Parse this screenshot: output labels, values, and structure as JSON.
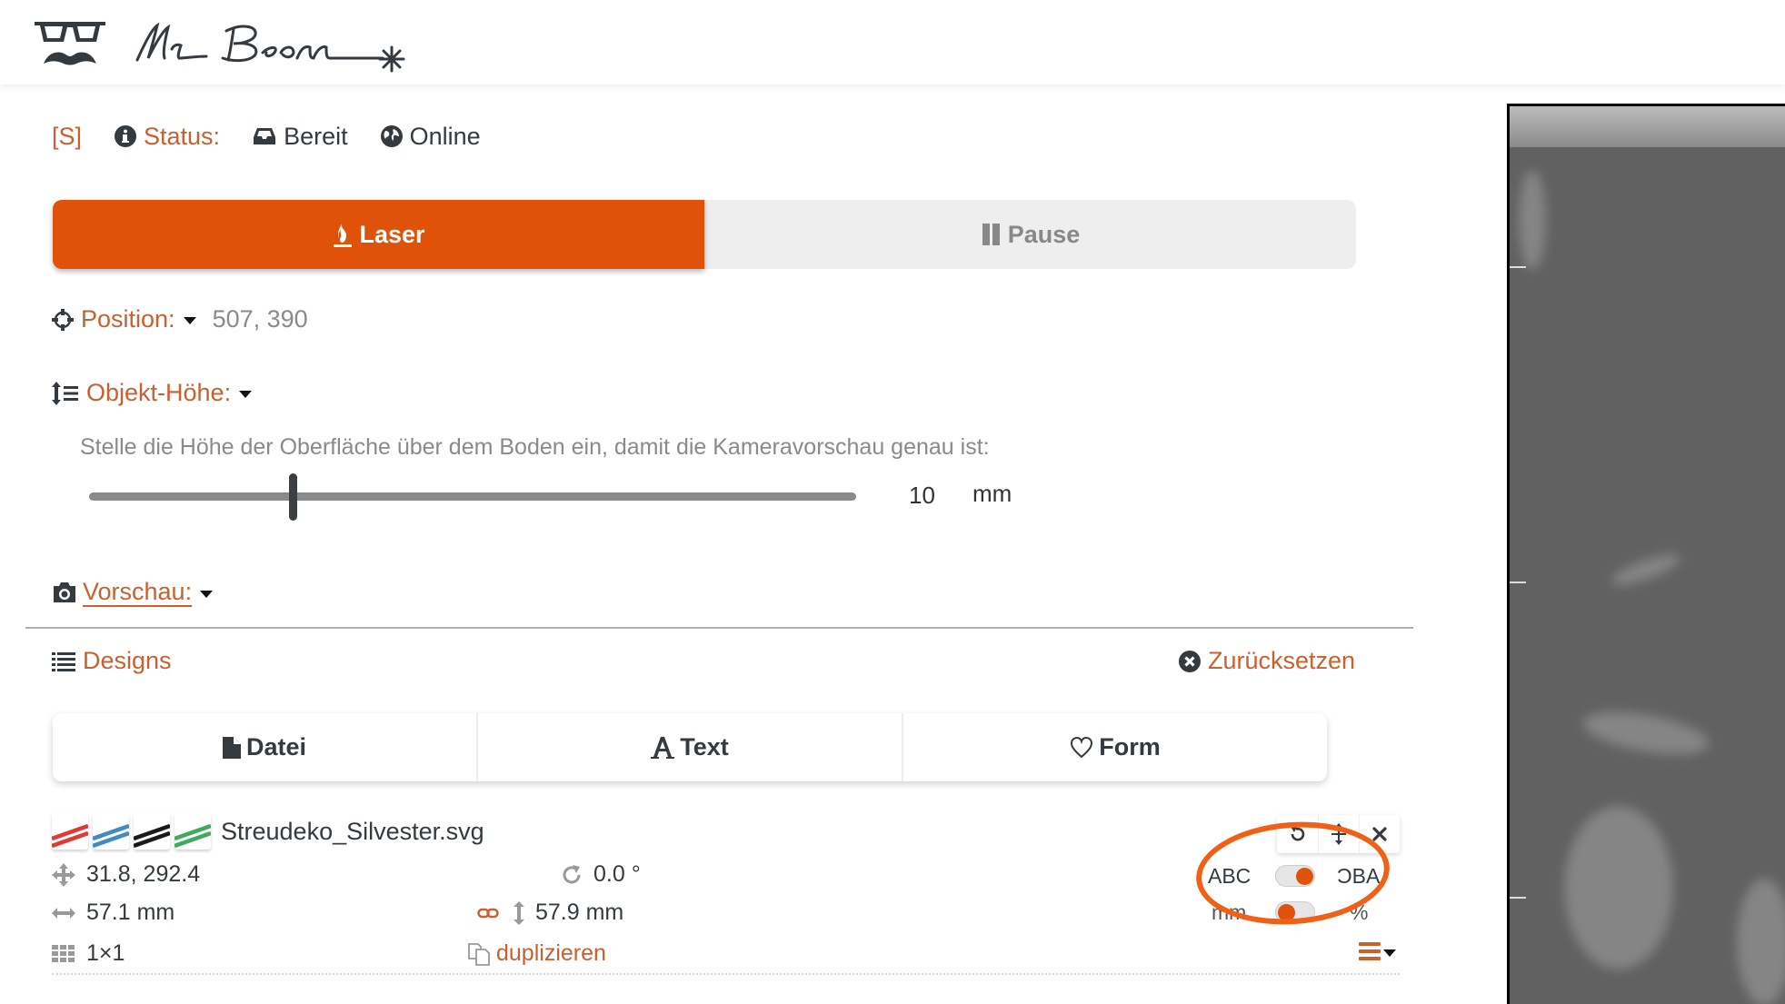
{
  "app": {
    "brand": "Mr Beam",
    "accent_color": "#e0520a",
    "link_color": "#c8602f"
  },
  "status_bar": {
    "shortcut": "[S]",
    "status_label": "Status:",
    "state": "Bereit",
    "connection": "Online"
  },
  "job_controls": {
    "laser_label": "Laser",
    "pause_label": "Pause"
  },
  "position": {
    "label": "Position:",
    "value": "507, 390"
  },
  "object_height": {
    "label": "Objekt-Höhe:",
    "help": "Stelle die Höhe der Oberfläche über dem Boden ein, damit die Kameravorschau genau ist:",
    "value": "10",
    "unit": "mm",
    "slider_min": 0,
    "slider_max": 38,
    "slider_fraction": 0.265
  },
  "preview": {
    "label": "Vorschau:"
  },
  "designs": {
    "label": "Designs",
    "reset_label": "Zurücksetzen",
    "tabs": [
      {
        "label": "Datei",
        "icon": "file-icon"
      },
      {
        "label": "Text",
        "icon": "font-icon"
      },
      {
        "label": "Form",
        "icon": "heart-icon"
      }
    ],
    "items": [
      {
        "file_name": "Streudeko_Silvester.svg",
        "colors": [
          "#e03a33",
          "#3d8cc4",
          "#1a1a1a",
          "#3faa5a"
        ],
        "position": "31.8, 292.4",
        "rotation": "0.0 °",
        "width": "57.1 mm",
        "height": "57.9 mm",
        "array": "1×1",
        "duplicate_label": "duplizieren",
        "mirror_left": "ABC",
        "mirror_right": "ƆBA",
        "mirror_on": true,
        "unit_left": "mm",
        "unit_right": "%",
        "unit_percent": false
      }
    ]
  }
}
